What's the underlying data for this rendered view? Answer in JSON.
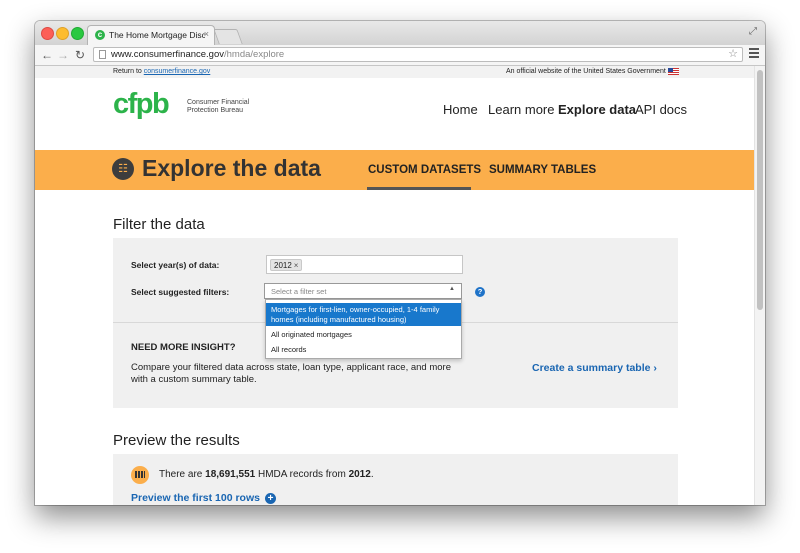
{
  "browser": {
    "tab_title": "The Home Mortgage Discl",
    "url_host": "www.consumerfinance.gov",
    "url_path": "/hmda/explore"
  },
  "utility_bar": {
    "return_prefix": "Return to",
    "return_link": "consumerfinance.gov",
    "official": "An official website of the United States Government"
  },
  "logo": {
    "mark": "cfpb",
    "line1": "Consumer Financial",
    "line2": "Protection Bureau"
  },
  "nav": [
    "Home",
    "Learn more",
    "Explore data",
    "API docs"
  ],
  "banner": {
    "title": "Explore the data",
    "tabs": [
      "CUSTOM DATASETS",
      "SUMMARY TABLES"
    ]
  },
  "filter": {
    "heading": "Filter the data",
    "year_label": "Select year(s) of data:",
    "year_chip": "2012",
    "suggested_label": "Select suggested filters:",
    "placeholder": "Select a filter set",
    "options": [
      "Mortgages for first-lien, owner-occupied, 1-4 family homes (including manufactured housing)",
      "All originated mortgages",
      "All records"
    ]
  },
  "insight": {
    "title": "NEED MORE INSIGHT?",
    "body": "Compare your filtered data across state, loan type, applicant race, and more with a custom summary table.",
    "link": "Create a summary table ›"
  },
  "preview": {
    "heading": "Preview the results",
    "prefix": "There are",
    "count": "18,691,551",
    "middle": "HMDA records from",
    "year": "2012",
    "suffix": ".",
    "link": "Preview the first 100 rows"
  }
}
